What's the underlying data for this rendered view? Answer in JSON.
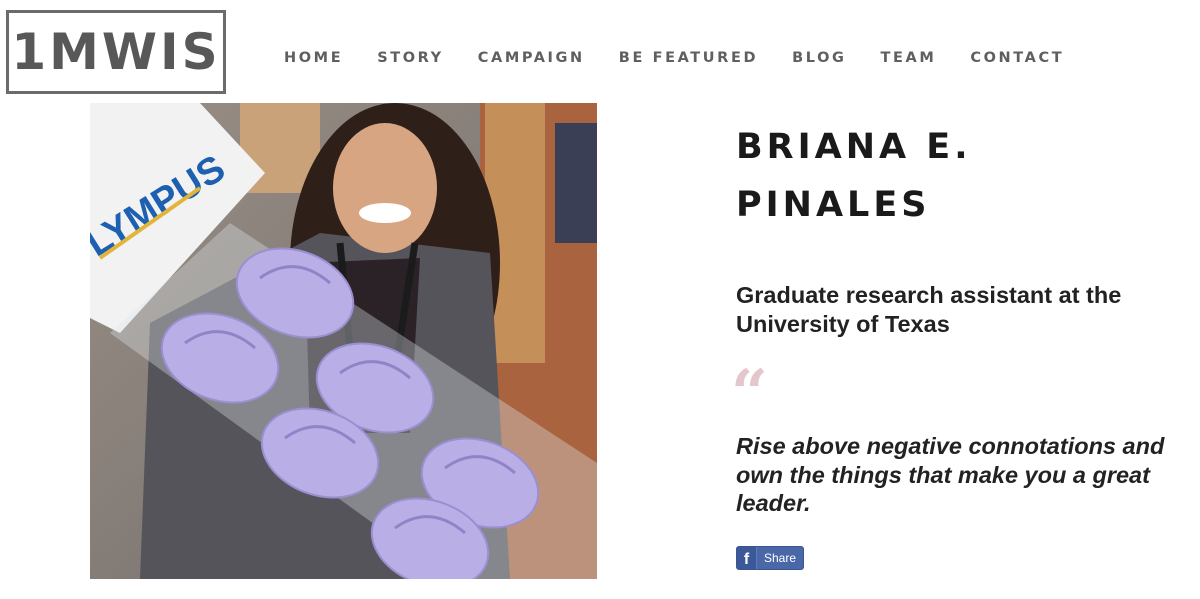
{
  "site": {
    "logo": "1MWIS"
  },
  "nav": {
    "items": [
      {
        "label": "HOME"
      },
      {
        "label": "STORY"
      },
      {
        "label": "CAMPAIGN"
      },
      {
        "label": "BE FEATURED"
      },
      {
        "label": "BLOG"
      },
      {
        "label": "TEAM"
      },
      {
        "label": "CONTACT"
      }
    ]
  },
  "profile": {
    "name_line1": "BRIANA E.",
    "name_line2": "PINALES",
    "role_line1": "Graduate research assistant at the",
    "role_line2": "University of Texas",
    "quote_mark": "“",
    "quote": "Rise above negative connotations and own the things that make you a great leader.",
    "photo_sign_text": "LYMPUS"
  },
  "share": {
    "label": "Share",
    "icon": "facebook-icon",
    "icon_glyph": "f"
  },
  "colors": {
    "nav_text": "#5f5f5f",
    "logo_border": "#6b6b6b",
    "quote_mark": "#e5c6cb",
    "share_bg": "#4a67a8",
    "brain_slices": "#b9aee6"
  }
}
